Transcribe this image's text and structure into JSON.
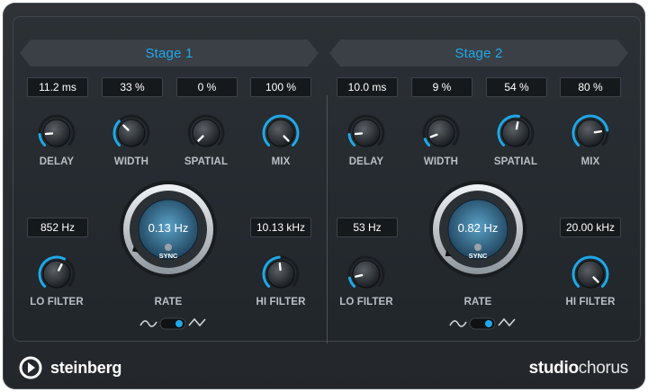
{
  "colors": {
    "accent": "#1fa8e8",
    "label": "#b9bfc5"
  },
  "brand": {
    "logo_text": "steinberg",
    "product_bold": "studio",
    "product_light": "chorus"
  },
  "stages": [
    {
      "title": "Stage 1",
      "delay": {
        "label": "DELAY",
        "value": "11.2 ms",
        "level": 0.15
      },
      "width": {
        "label": "WIDTH",
        "value": "33 %",
        "level": 0.33
      },
      "spatial": {
        "label": "SPATIAL",
        "value": "0 %",
        "level": 0.0
      },
      "mix": {
        "label": "MIX",
        "value": "100 %",
        "level": 1.0
      },
      "lo_filter": {
        "label": "LO FILTER",
        "value": "852 Hz",
        "level": 0.6
      },
      "rate": {
        "label": "RATE",
        "value": "0.13 Hz",
        "sync_label": "SYNC",
        "level": 0.05
      },
      "hi_filter": {
        "label": "HI FILTER",
        "value": "10.13 kHz",
        "level": 0.48
      },
      "waveform": "triangle"
    },
    {
      "title": "Stage 2",
      "delay": {
        "label": "DELAY",
        "value": "10.0 ms",
        "level": 0.15
      },
      "width": {
        "label": "WIDTH",
        "value": "9 %",
        "level": 0.09
      },
      "spatial": {
        "label": "SPATIAL",
        "value": "54 %",
        "level": 0.54
      },
      "mix": {
        "label": "MIX",
        "value": "80 %",
        "level": 0.8
      },
      "lo_filter": {
        "label": "LO FILTER",
        "value": "53 Hz",
        "level": 0.12
      },
      "rate": {
        "label": "RATE",
        "value": "0.82 Hz",
        "sync_label": "SYNC",
        "level": 0.02
      },
      "hi_filter": {
        "label": "HI FILTER",
        "value": "20.00 kHz",
        "level": 1.0
      },
      "waveform": "triangle"
    }
  ]
}
